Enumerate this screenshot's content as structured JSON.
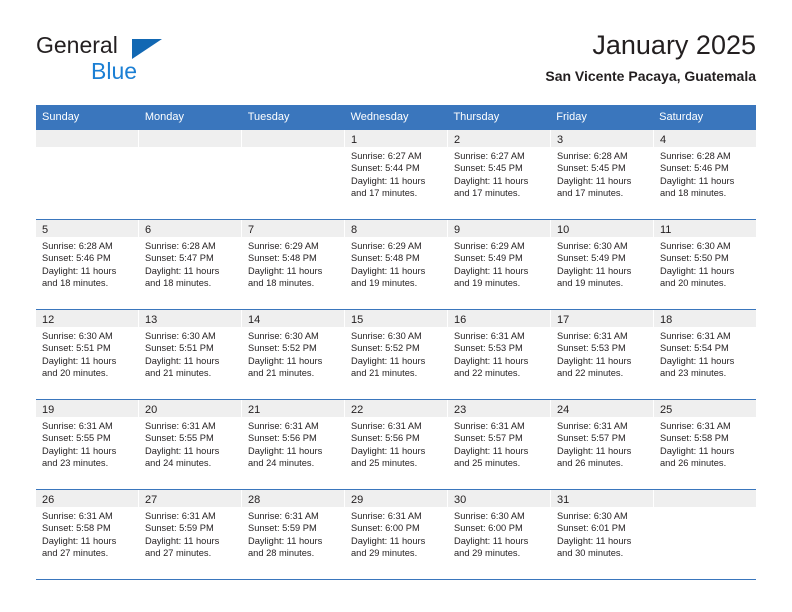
{
  "logo": {
    "word_dark": "General",
    "word_blue": "Blue",
    "triangle_color": "#1268b3",
    "blue_color": "#1b7fd4"
  },
  "header": {
    "title": "January 2025",
    "subtitle": "San Vicente Pacaya, Guatemala"
  },
  "theme": {
    "header_row_bg": "#3a76bd",
    "header_row_text": "#ffffff",
    "day_number_bg": "#efefef",
    "text": "#231f20"
  },
  "weekdays": [
    "Sunday",
    "Monday",
    "Tuesday",
    "Wednesday",
    "Thursday",
    "Friday",
    "Saturday"
  ],
  "weeks": [
    [
      {
        "day": "",
        "lines": []
      },
      {
        "day": "",
        "lines": []
      },
      {
        "day": "",
        "lines": []
      },
      {
        "day": "1",
        "lines": [
          "Sunrise: 6:27 AM",
          "Sunset: 5:44 PM",
          "Daylight: 11 hours",
          "and 17 minutes."
        ]
      },
      {
        "day": "2",
        "lines": [
          "Sunrise: 6:27 AM",
          "Sunset: 5:45 PM",
          "Daylight: 11 hours",
          "and 17 minutes."
        ]
      },
      {
        "day": "3",
        "lines": [
          "Sunrise: 6:28 AM",
          "Sunset: 5:45 PM",
          "Daylight: 11 hours",
          "and 17 minutes."
        ]
      },
      {
        "day": "4",
        "lines": [
          "Sunrise: 6:28 AM",
          "Sunset: 5:46 PM",
          "Daylight: 11 hours",
          "and 18 minutes."
        ]
      }
    ],
    [
      {
        "day": "5",
        "lines": [
          "Sunrise: 6:28 AM",
          "Sunset: 5:46 PM",
          "Daylight: 11 hours",
          "and 18 minutes."
        ]
      },
      {
        "day": "6",
        "lines": [
          "Sunrise: 6:28 AM",
          "Sunset: 5:47 PM",
          "Daylight: 11 hours",
          "and 18 minutes."
        ]
      },
      {
        "day": "7",
        "lines": [
          "Sunrise: 6:29 AM",
          "Sunset: 5:48 PM",
          "Daylight: 11 hours",
          "and 18 minutes."
        ]
      },
      {
        "day": "8",
        "lines": [
          "Sunrise: 6:29 AM",
          "Sunset: 5:48 PM",
          "Daylight: 11 hours",
          "and 19 minutes."
        ]
      },
      {
        "day": "9",
        "lines": [
          "Sunrise: 6:29 AM",
          "Sunset: 5:49 PM",
          "Daylight: 11 hours",
          "and 19 minutes."
        ]
      },
      {
        "day": "10",
        "lines": [
          "Sunrise: 6:30 AM",
          "Sunset: 5:49 PM",
          "Daylight: 11 hours",
          "and 19 minutes."
        ]
      },
      {
        "day": "11",
        "lines": [
          "Sunrise: 6:30 AM",
          "Sunset: 5:50 PM",
          "Daylight: 11 hours",
          "and 20 minutes."
        ]
      }
    ],
    [
      {
        "day": "12",
        "lines": [
          "Sunrise: 6:30 AM",
          "Sunset: 5:51 PM",
          "Daylight: 11 hours",
          "and 20 minutes."
        ]
      },
      {
        "day": "13",
        "lines": [
          "Sunrise: 6:30 AM",
          "Sunset: 5:51 PM",
          "Daylight: 11 hours",
          "and 21 minutes."
        ]
      },
      {
        "day": "14",
        "lines": [
          "Sunrise: 6:30 AM",
          "Sunset: 5:52 PM",
          "Daylight: 11 hours",
          "and 21 minutes."
        ]
      },
      {
        "day": "15",
        "lines": [
          "Sunrise: 6:30 AM",
          "Sunset: 5:52 PM",
          "Daylight: 11 hours",
          "and 21 minutes."
        ]
      },
      {
        "day": "16",
        "lines": [
          "Sunrise: 6:31 AM",
          "Sunset: 5:53 PM",
          "Daylight: 11 hours",
          "and 22 minutes."
        ]
      },
      {
        "day": "17",
        "lines": [
          "Sunrise: 6:31 AM",
          "Sunset: 5:53 PM",
          "Daylight: 11 hours",
          "and 22 minutes."
        ]
      },
      {
        "day": "18",
        "lines": [
          "Sunrise: 6:31 AM",
          "Sunset: 5:54 PM",
          "Daylight: 11 hours",
          "and 23 minutes."
        ]
      }
    ],
    [
      {
        "day": "19",
        "lines": [
          "Sunrise: 6:31 AM",
          "Sunset: 5:55 PM",
          "Daylight: 11 hours",
          "and 23 minutes."
        ]
      },
      {
        "day": "20",
        "lines": [
          "Sunrise: 6:31 AM",
          "Sunset: 5:55 PM",
          "Daylight: 11 hours",
          "and 24 minutes."
        ]
      },
      {
        "day": "21",
        "lines": [
          "Sunrise: 6:31 AM",
          "Sunset: 5:56 PM",
          "Daylight: 11 hours",
          "and 24 minutes."
        ]
      },
      {
        "day": "22",
        "lines": [
          "Sunrise: 6:31 AM",
          "Sunset: 5:56 PM",
          "Daylight: 11 hours",
          "and 25 minutes."
        ]
      },
      {
        "day": "23",
        "lines": [
          "Sunrise: 6:31 AM",
          "Sunset: 5:57 PM",
          "Daylight: 11 hours",
          "and 25 minutes."
        ]
      },
      {
        "day": "24",
        "lines": [
          "Sunrise: 6:31 AM",
          "Sunset: 5:57 PM",
          "Daylight: 11 hours",
          "and 26 minutes."
        ]
      },
      {
        "day": "25",
        "lines": [
          "Sunrise: 6:31 AM",
          "Sunset: 5:58 PM",
          "Daylight: 11 hours",
          "and 26 minutes."
        ]
      }
    ],
    [
      {
        "day": "26",
        "lines": [
          "Sunrise: 6:31 AM",
          "Sunset: 5:58 PM",
          "Daylight: 11 hours",
          "and 27 minutes."
        ]
      },
      {
        "day": "27",
        "lines": [
          "Sunrise: 6:31 AM",
          "Sunset: 5:59 PM",
          "Daylight: 11 hours",
          "and 27 minutes."
        ]
      },
      {
        "day": "28",
        "lines": [
          "Sunrise: 6:31 AM",
          "Sunset: 5:59 PM",
          "Daylight: 11 hours",
          "and 28 minutes."
        ]
      },
      {
        "day": "29",
        "lines": [
          "Sunrise: 6:31 AM",
          "Sunset: 6:00 PM",
          "Daylight: 11 hours",
          "and 29 minutes."
        ]
      },
      {
        "day": "30",
        "lines": [
          "Sunrise: 6:30 AM",
          "Sunset: 6:00 PM",
          "Daylight: 11 hours",
          "and 29 minutes."
        ]
      },
      {
        "day": "31",
        "lines": [
          "Sunrise: 6:30 AM",
          "Sunset: 6:01 PM",
          "Daylight: 11 hours",
          "and 30 minutes."
        ]
      },
      {
        "day": "",
        "lines": []
      }
    ]
  ]
}
